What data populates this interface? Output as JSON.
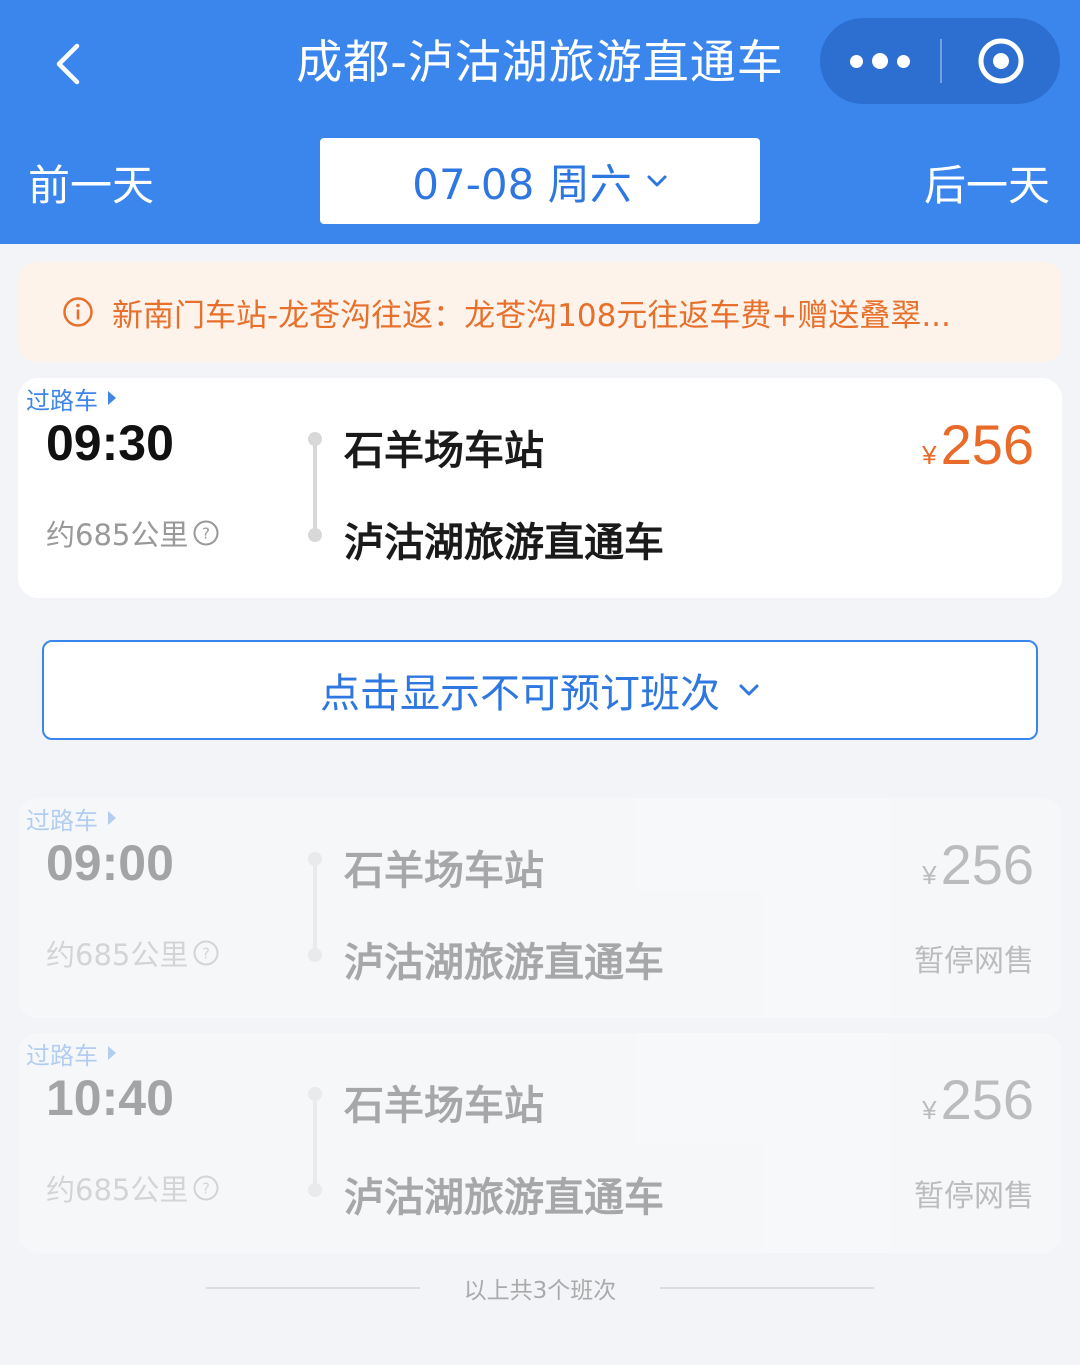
{
  "header": {
    "title": "成都-泸沽湖旅游直通车",
    "prev_day": "前一天",
    "next_day": "后一天",
    "date": "07-08 周六"
  },
  "notice": {
    "text": "新南门车站-龙苍沟往返：龙苍沟108元往返车费+赠送叠翠..."
  },
  "schedules": [
    {
      "tag": "过路车",
      "time": "09:30",
      "distance": "约685公里",
      "from": "石羊场车站",
      "to": "泸沽湖旅游直通车",
      "currency": "¥",
      "price": "256",
      "status": "",
      "bookable": true
    },
    {
      "tag": "过路车",
      "time": "09:00",
      "distance": "约685公里",
      "from": "石羊场车站",
      "to": "泸沽湖旅游直通车",
      "currency": "¥",
      "price": "256",
      "status": "暂停网售",
      "bookable": false
    },
    {
      "tag": "过路车",
      "time": "10:40",
      "distance": "约685公里",
      "from": "石羊场车站",
      "to": "泸沽湖旅游直通车",
      "currency": "¥",
      "price": "256",
      "status": "暂停网售",
      "bookable": false
    }
  ],
  "toggle": {
    "label": "点击显示不可预订班次"
  },
  "footer": {
    "text": "以上共3个班次"
  },
  "colors": {
    "brand_blue": "#3b86ec",
    "price_orange": "#e96b2a",
    "notice_bg": "#fdf3ea"
  }
}
